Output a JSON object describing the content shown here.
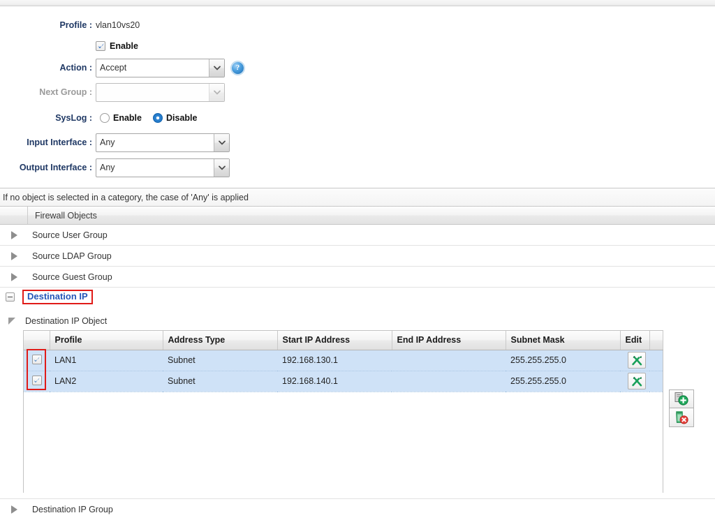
{
  "form": {
    "profile": {
      "label": "Profile :",
      "value": "vlan10vs20"
    },
    "enable": {
      "label": "Enable",
      "checked": true
    },
    "action": {
      "label": "Action :",
      "value": "Accept",
      "help": "?"
    },
    "next_group": {
      "label": "Next Group :",
      "value": "",
      "disabled": true
    },
    "syslog": {
      "label": "SysLog :",
      "enable_label": "Enable",
      "disable_label": "Disable",
      "selected": "Disable"
    },
    "input_interface": {
      "label": "Input Interface :",
      "value": "Any"
    },
    "output_interface": {
      "label": "Output Interface :",
      "value": "Any"
    }
  },
  "notice": "If no object is selected in a category, the case of 'Any' is applied",
  "tree": {
    "header": "Firewall Objects",
    "items": [
      {
        "label": "Source User Group",
        "expanded": false
      },
      {
        "label": "Source LDAP Group",
        "expanded": false
      },
      {
        "label": "Source Guest Group",
        "expanded": false
      }
    ],
    "expanded_node": {
      "label": "Destination IP",
      "highlighted": true
    },
    "sub_node": {
      "label": "Destination IP Object"
    },
    "last_item": {
      "label": "Destination IP Group",
      "expanded": false
    }
  },
  "table": {
    "columns": [
      "Profile",
      "Address Type",
      "Start IP Address",
      "End IP Address",
      "Subnet Mask",
      "Edit"
    ],
    "rows": [
      {
        "checked": true,
        "profile": "LAN1",
        "address_type": "Subnet",
        "start_ip": "192.168.130.1",
        "end_ip": "",
        "subnet_mask": "255.255.255.0",
        "edit_icon": "tools-icon"
      },
      {
        "checked": true,
        "profile": "LAN2",
        "address_type": "Subnet",
        "start_ip": "192.168.140.1",
        "end_ip": "",
        "subnet_mask": "255.255.255.0",
        "edit_icon": "tools-icon"
      }
    ]
  },
  "side_actions": {
    "add": {
      "name": "add-object-button",
      "icon": "document-add-icon"
    },
    "delete": {
      "name": "delete-object-button",
      "icon": "trash-delete-icon"
    }
  },
  "colors": {
    "label_blue": "#1f3864",
    "node_blue": "#2456b8",
    "highlight_red": "#e01b18",
    "row_selected": "#cfe2f7",
    "icon_green": "#18a05a"
  }
}
